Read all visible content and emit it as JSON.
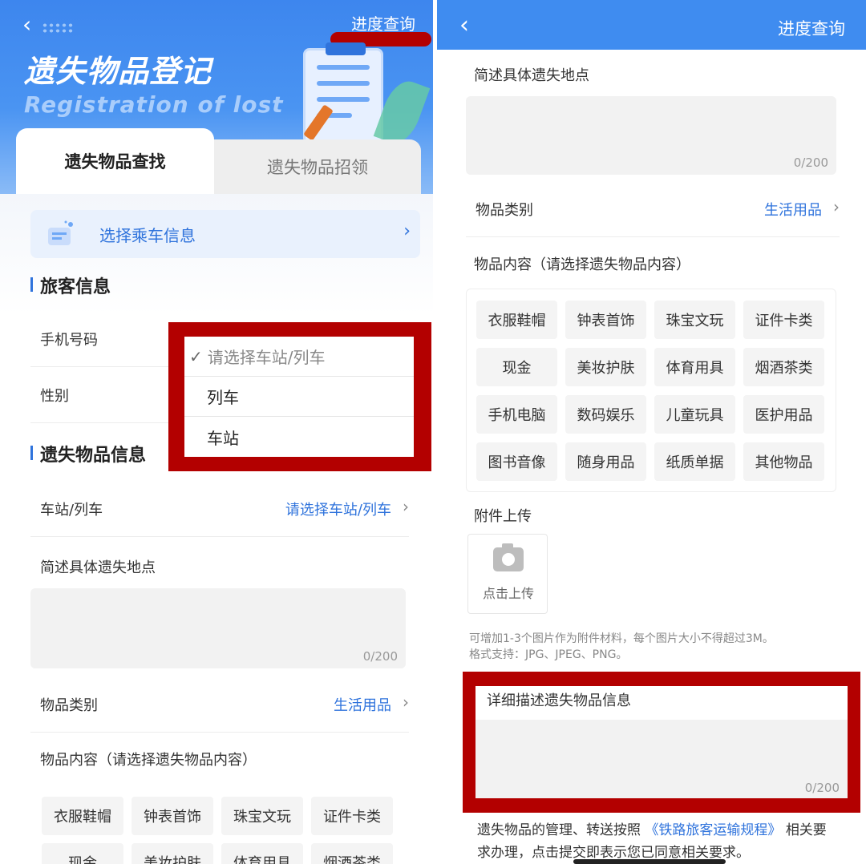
{
  "left": {
    "header": {
      "progress": "进度查询",
      "title": "遗失物品登记",
      "subtitle": "Registration of lost"
    },
    "tabs": {
      "active": "遗失物品查找",
      "inactive": "遗失物品招领"
    },
    "ride_info": "选择乘车信息",
    "passenger_section": "旅客信息",
    "phone_label": "手机号码",
    "gender_label": "性别",
    "dropdown": {
      "placeholder": "请选择车站/列车",
      "options": [
        "列车",
        "车站"
      ]
    },
    "lost_section": "遗失物品信息",
    "station_label": "车站/列车",
    "station_value": "请选择车站/列车",
    "location_label": "简述具体遗失地点",
    "location_count": "0/200",
    "category_label": "物品类别",
    "category_value": "生活用品",
    "content_label": "物品内容（请选择遗失物品内容）",
    "chips": [
      "衣服鞋帽",
      "钟表首饰",
      "珠宝文玩",
      "证件卡类",
      "现金",
      "美妆护肤",
      "体育用具",
      "烟酒茶类"
    ]
  },
  "right": {
    "header": {
      "progress": "进度查询"
    },
    "location_label": "简述具体遗失地点",
    "location_count": "0/200",
    "category_label": "物品类别",
    "category_value": "生活用品",
    "content_label": "物品内容（请选择遗失物品内容）",
    "chips": [
      "衣服鞋帽",
      "钟表首饰",
      "珠宝文玩",
      "证件卡类",
      "现金",
      "美妆护肤",
      "体育用具",
      "烟酒茶类",
      "手机电脑",
      "数码娱乐",
      "儿童玩具",
      "医护用品",
      "图书音像",
      "随身用品",
      "纸质单据",
      "其他物品"
    ],
    "attach_label": "附件上传",
    "upload_label": "点击上传",
    "hint_line1": "可增加1-3个图片作为附件材料，每个图片大小不得超过3M。",
    "hint_line2": "格式支持：JPG、JPEG、PNG。",
    "detail_label": "详细描述遗失物品信息",
    "detail_count": "0/200",
    "agree_pre": "遗失物品的管理、转送按照",
    "agree_link": "《铁路旅客运输规程》",
    "agree_post": "相关要求办理，点击提交即表示您已同意相关要求。"
  },
  "colors": {
    "brand_blue": "#3f8cf0",
    "link_blue": "#2f73dc",
    "redaction_red": "#b30000"
  }
}
